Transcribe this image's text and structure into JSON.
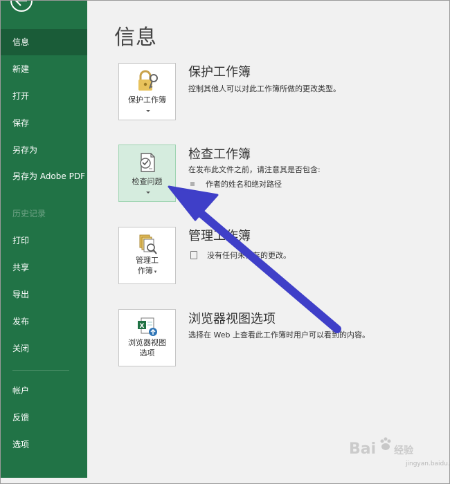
{
  "colors": {
    "sidebar_bg": "#217346",
    "sidebar_selected": "#1a5c38",
    "main_bg": "#f1f1f1",
    "tile_active_bg": "#d5ecde",
    "annotation_arrow": "#3f3fc8"
  },
  "sidebar": {
    "back_icon": "back-arrow-icon",
    "items": [
      {
        "label": "信息",
        "selected": true
      },
      {
        "label": "新建"
      },
      {
        "label": "打开"
      },
      {
        "label": "保存"
      },
      {
        "label": "另存为"
      },
      {
        "label": "另存为 Adobe PDF"
      },
      {
        "label": "历史记录",
        "disabled": true
      },
      {
        "label": "打印"
      },
      {
        "label": "共享"
      },
      {
        "label": "导出"
      },
      {
        "label": "发布"
      },
      {
        "label": "关闭"
      },
      {
        "label": "帐户"
      },
      {
        "label": "反馈"
      },
      {
        "label": "选项"
      }
    ]
  },
  "main": {
    "title": "信息",
    "sections": [
      {
        "button_label": "保护工作簿",
        "icon": "lock-key-icon",
        "title": "保护工作簿",
        "description": "控制其他人可以对此工作簿所做的更改类型。"
      },
      {
        "button_label": "检查问题",
        "icon": "checklist-icon",
        "title": "检查工作簿",
        "description": "在发布此文件之前，请注意其是否包含:",
        "bullets": [
          "作者的姓名和绝对路径"
        ]
      },
      {
        "button_label_line1": "管理工",
        "button_label_line2": "作簿",
        "icon": "manage-workbook-icon",
        "title": "管理工作簿",
        "note": "没有任何未保存的更改。"
      },
      {
        "button_label_line1": "浏览器视图",
        "button_label_line2": "选项",
        "icon": "excel-browser-icon",
        "title": "浏览器视图选项",
        "description": "选择在 Web 上查看此工作簿时用户可以看到的内容。"
      }
    ]
  },
  "watermark": {
    "text": "Bai",
    "text2": "经验",
    "site": "jingyan.baidu.com"
  }
}
